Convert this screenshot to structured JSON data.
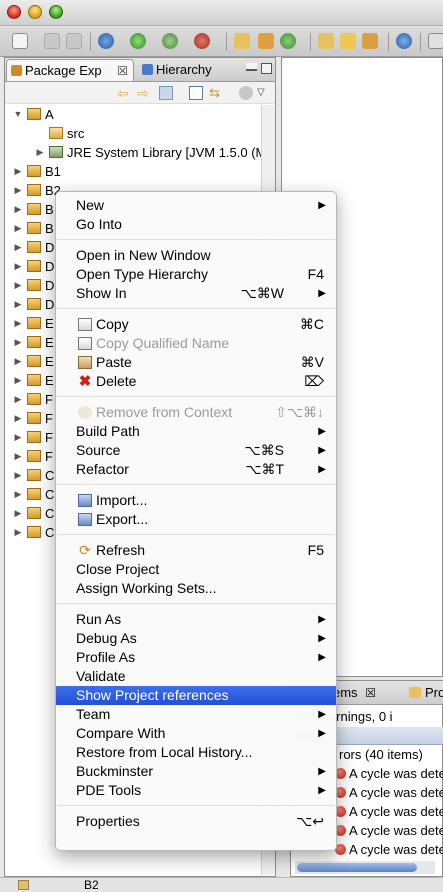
{
  "left_panel": {
    "tabs": [
      {
        "label": "Package Exp",
        "close": "☒"
      },
      {
        "label": "Hierarchy"
      }
    ]
  },
  "tree": [
    {
      "arrow": "▼",
      "label": "A",
      "indent": 0
    },
    {
      "arrow": "",
      "label": "src",
      "indent": 1
    },
    {
      "arrow": "▶",
      "label": "JRE System Library [JVM 1.5.0 (M",
      "indent": 1
    },
    {
      "arrow": "▶",
      "label": "B1",
      "indent": 0
    },
    {
      "arrow": "▶",
      "label": "B2",
      "indent": 0
    },
    {
      "arrow": "▶",
      "label": "B",
      "indent": 0
    },
    {
      "arrow": "▶",
      "label": "B",
      "indent": 0
    },
    {
      "arrow": "▶",
      "label": "D",
      "indent": 0
    },
    {
      "arrow": "▶",
      "label": "D",
      "indent": 0
    },
    {
      "arrow": "▶",
      "label": "D",
      "indent": 0
    },
    {
      "arrow": "▶",
      "label": "D",
      "indent": 0
    },
    {
      "arrow": "▶",
      "label": "E",
      "indent": 0
    },
    {
      "arrow": "▶",
      "label": "E",
      "indent": 0
    },
    {
      "arrow": "▶",
      "label": "E",
      "indent": 0
    },
    {
      "arrow": "▶",
      "label": "E",
      "indent": 0
    },
    {
      "arrow": "▶",
      "label": "F",
      "indent": 0
    },
    {
      "arrow": "▶",
      "label": "F",
      "indent": 0
    },
    {
      "arrow": "▶",
      "label": "F",
      "indent": 0
    },
    {
      "arrow": "▶",
      "label": "F",
      "indent": 0
    },
    {
      "arrow": "▶",
      "label": "C",
      "indent": 0
    },
    {
      "arrow": "▶",
      "label": "C",
      "indent": 0
    },
    {
      "arrow": "▶",
      "label": "C",
      "indent": 0
    },
    {
      "arrow": "▶",
      "label": "C",
      "indent": 0
    }
  ],
  "problems": {
    "tab_label": "ems",
    "tab_close": "☒",
    "tab2_label": "Pro",
    "summary": "s, 0 warnings, 0 i",
    "column_header": "iption",
    "group_label": "rors (40 items)",
    "rows": [
      "A cycle was dete",
      "A cycle was dete",
      "A cycle was dete",
      "A cycle was dete",
      "A cycle was dete"
    ]
  },
  "status": {
    "selected": "B2"
  },
  "context_menu": {
    "items": [
      {
        "label": "New",
        "submenu": true
      },
      {
        "label": "Go Into"
      },
      {
        "separator": true
      },
      {
        "label": "Open in New Window"
      },
      {
        "label": "Open Type Hierarchy",
        "shortcut": "F4",
        "fkey": true
      },
      {
        "label": "Show In",
        "shortcut": "⌥⌘W",
        "submenu": true
      },
      {
        "separator": true
      },
      {
        "label": "Copy",
        "shortcut": "⌘C",
        "icon": "copy-icon"
      },
      {
        "label": "Copy Qualified Name",
        "icon": "copy-icon",
        "disabled": true
      },
      {
        "label": "Paste",
        "shortcut": "⌘V",
        "icon": "paste-icon"
      },
      {
        "label": "Delete",
        "shortcut": "⌦",
        "icon": "delete-icon"
      },
      {
        "separator": true
      },
      {
        "label": "Remove from Context",
        "shortcut": "⇧⌥⌘↓",
        "icon": "remove-context-icon",
        "disabled": true
      },
      {
        "label": "Build Path",
        "submenu": true
      },
      {
        "label": "Source",
        "shortcut": "⌥⌘S",
        "submenu": true
      },
      {
        "label": "Refactor",
        "shortcut": "⌥⌘T",
        "submenu": true
      },
      {
        "separator": true
      },
      {
        "label": "Import...",
        "icon": "import-icon"
      },
      {
        "label": "Export...",
        "icon": "export-icon"
      },
      {
        "separator": true
      },
      {
        "label": "Refresh",
        "shortcut": "F5",
        "icon": "refresh-icon",
        "fkey": true
      },
      {
        "label": "Close Project"
      },
      {
        "label": "Assign Working Sets..."
      },
      {
        "separator": true
      },
      {
        "label": "Run As",
        "submenu": true
      },
      {
        "label": "Debug As",
        "submenu": true
      },
      {
        "label": "Profile As",
        "submenu": true
      },
      {
        "label": "Validate"
      },
      {
        "label": "Show Project references",
        "highlighted": true
      },
      {
        "label": "Team",
        "submenu": true
      },
      {
        "label": "Compare With",
        "submenu": true
      },
      {
        "label": "Restore from Local History..."
      },
      {
        "label": "Buckminster",
        "submenu": true
      },
      {
        "label": "PDE Tools",
        "submenu": true
      },
      {
        "separator": true
      },
      {
        "label": "Properties",
        "shortcut": "⌥↩",
        "fkey": true
      }
    ]
  },
  "colors": {
    "highlight": "#2a5ae0",
    "project_icon": "#e0a020",
    "error_icon": "#d02010"
  }
}
